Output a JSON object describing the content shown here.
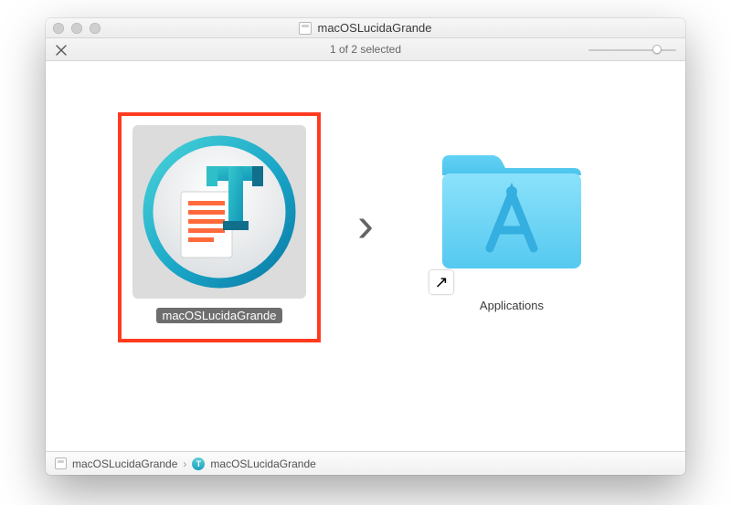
{
  "window": {
    "title": "macOSLucidaGrande",
    "status": "1 of 2 selected"
  },
  "items": {
    "app": {
      "label": "macOSLucidaGrande",
      "selected": true,
      "icon": "app-lucida-grande-icon"
    },
    "applications": {
      "label": "Applications",
      "selected": false,
      "icon": "applications-folder-icon"
    }
  },
  "arrow_glyph": "›",
  "pathbar": {
    "segments": [
      {
        "label": "macOSLucidaGrande",
        "icon": "disk-icon"
      },
      {
        "label": "macOSLucidaGrande",
        "icon": "app-mini-icon"
      }
    ],
    "separator": "›"
  }
}
